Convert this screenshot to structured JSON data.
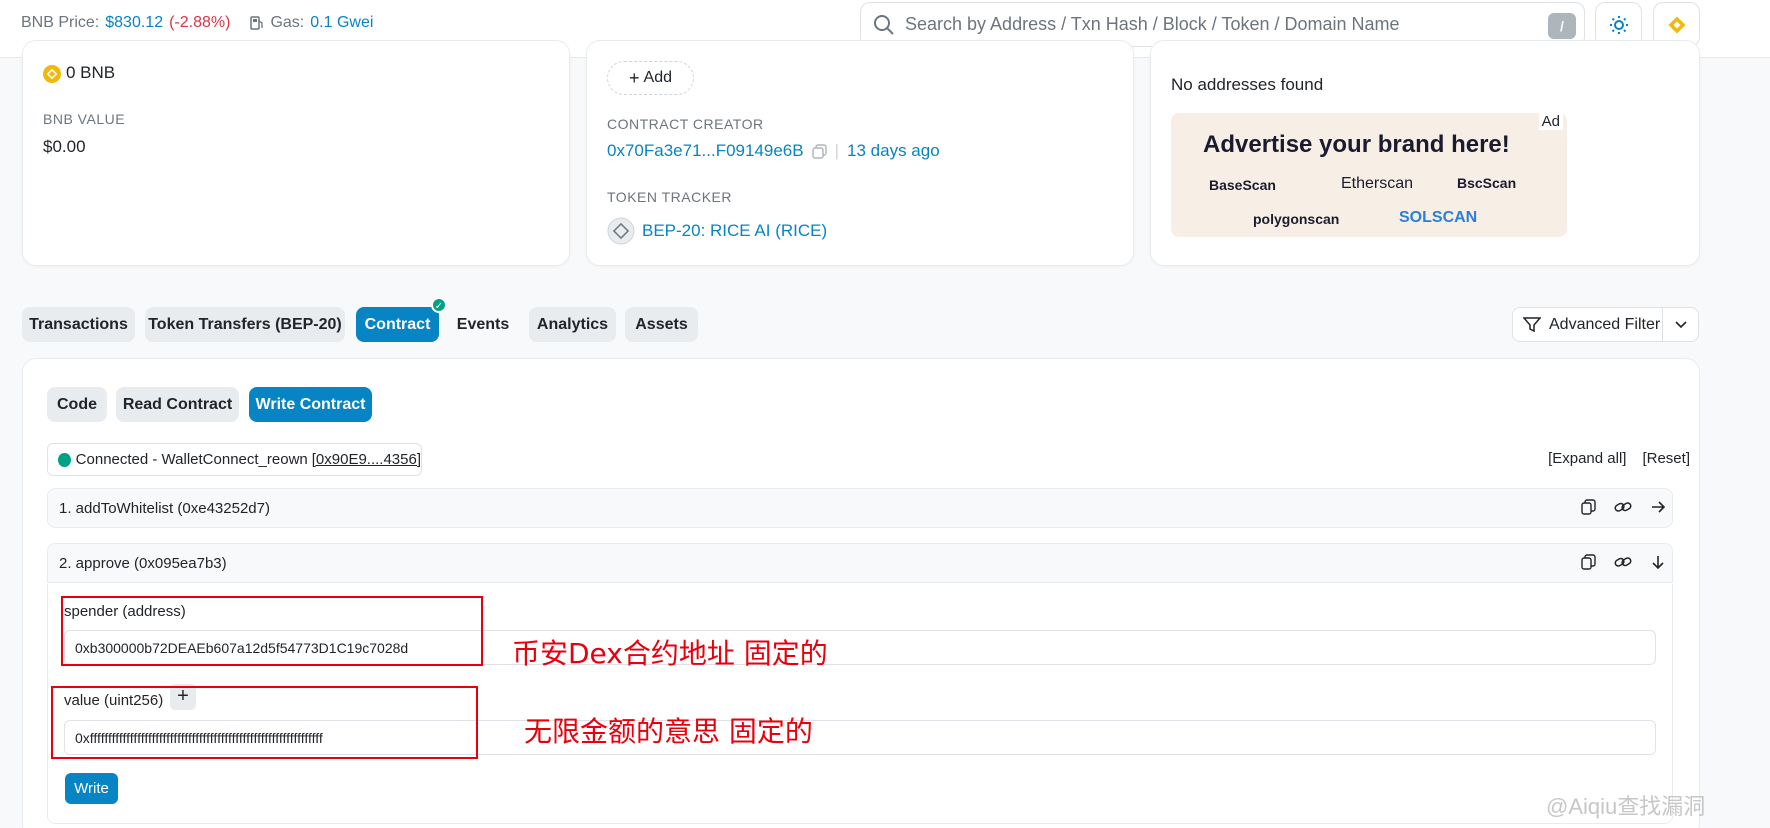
{
  "topbar": {
    "price_label": "BNB Price:",
    "price_value": "$830.12",
    "price_change": "(-2.88%)",
    "gas_label": "Gas:",
    "gas_value": "0.1 Gwei",
    "search_placeholder": "Search by Address / Txn Hash / Block / Token / Domain Name",
    "slash_key": "/"
  },
  "overview": {
    "bnb_balance": "0 BNB",
    "bnb_value_label": "BNB VALUE",
    "bnb_value": "$0.00"
  },
  "more_info": {
    "add_button": "Add",
    "creator_label": "CONTRACT CREATOR",
    "creator_address": "0x70Fa3e71...F09149e6B",
    "creator_separator": "|",
    "creator_age": "13 days ago",
    "token_tracker_label": "TOKEN TRACKER",
    "token_tracker_value": "BEP-20: RICE AI (RICE)"
  },
  "multichain": {
    "no_addresses": "No addresses found",
    "ad_tag": "Ad",
    "ad_headline": "Advertise your brand here!",
    "ad_brands": [
      "BaseScan",
      "Etherscan",
      "BscScan",
      "polygonscan",
      "SOLSCAN"
    ]
  },
  "tabs": [
    "Transactions",
    "Token Transfers (BEP-20)",
    "Contract",
    "Events",
    "Analytics",
    "Assets"
  ],
  "advanced_filter": "Advanced Filter",
  "contract": {
    "subtabs": [
      "Code",
      "Read Contract",
      "Write Contract"
    ],
    "connection_text": "Connected - WalletConnect_reown",
    "connection_address": "[0x90E9....4356]",
    "expand_all": "[Expand all]",
    "reset": "[Reset]",
    "functions": [
      {
        "title": "1. addToWhitelist (0xe43252d7)"
      },
      {
        "title": "2. approve (0x095ea7b3)"
      }
    ],
    "params": [
      {
        "label": "spender (address)",
        "value": "0xb300000b72DEAEb607a12d5f54773D1C19c7028d"
      },
      {
        "label": "value (uint256)",
        "value": "0xffffffffffffffffffffffffffffffffffffffffffffffffffffffffffffffff"
      }
    ],
    "plus": "+",
    "write_button": "Write"
  },
  "annotations": {
    "spender_note": "币安Dex合约地址 固定的",
    "value_note": "无限金额的意思 固定的",
    "watermark": "@Aiqiu查找漏洞"
  },
  "colors": {
    "accent": "#0784c3",
    "negative": "#dc3545",
    "success": "#00a186",
    "annotation_red": "#e8000c"
  }
}
